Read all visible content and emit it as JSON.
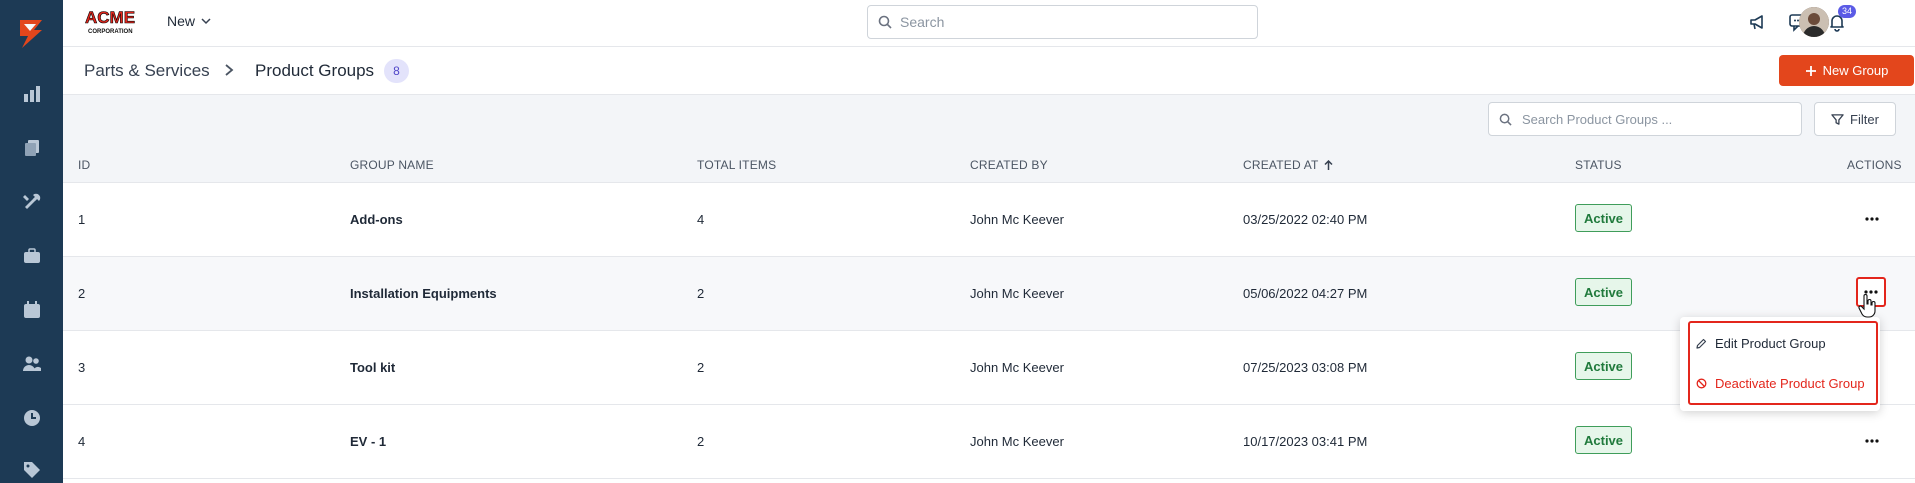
{
  "app": {
    "brand": "ACME CORPORATION",
    "new_menu_label": "New"
  },
  "top_search": {
    "placeholder": "Search"
  },
  "notifications": {
    "count": "34"
  },
  "breadcrumb": {
    "parent": "Parts & Services",
    "current": "Product Groups",
    "count": "8"
  },
  "new_group_button": "New Group",
  "product_group_search": {
    "placeholder": "Search Product Groups ..."
  },
  "filter_button": "Filter",
  "table": {
    "headers": {
      "id": "ID",
      "group_name": "GROUP NAME",
      "total_items": "TOTAL ITEMS",
      "created_by": "CREATED BY",
      "created_at": "CREATED AT",
      "status": "STATUS",
      "actions": "ACTIONS"
    },
    "rows": [
      {
        "id": "1",
        "group_name": "Add-ons",
        "total_items": "4",
        "created_by": "John Mc Keever",
        "created_at": "03/25/2022 02:40 PM",
        "status": "Active"
      },
      {
        "id": "2",
        "group_name": "Installation Equipments",
        "total_items": "2",
        "created_by": "John Mc Keever",
        "created_at": "05/06/2022 04:27 PM",
        "status": "Active"
      },
      {
        "id": "3",
        "group_name": "Tool kit",
        "total_items": "2",
        "created_by": "John Mc Keever",
        "created_at": "07/25/2023 03:08 PM",
        "status": "Active"
      },
      {
        "id": "4",
        "group_name": "EV - 1",
        "total_items": "2",
        "created_by": "John Mc Keever",
        "created_at": "10/17/2023 03:41 PM",
        "status": "Active"
      }
    ]
  },
  "row_actions_menu": {
    "edit": "Edit Product Group",
    "deactivate": "Deactivate Product Group"
  },
  "colors": {
    "sidebar": "#1d3a55",
    "accent": "#e3461c",
    "status_active_bg": "#e6f6ea",
    "status_active_border": "#3f9d5a",
    "highlight": "#e3261c"
  }
}
